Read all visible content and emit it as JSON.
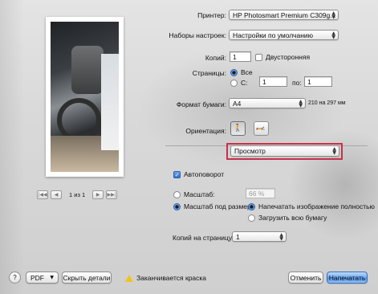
{
  "printer": {
    "label": "Принтер:",
    "value": "HP Photosmart Premium C309g..."
  },
  "presets": {
    "label": "Наборы настроек:",
    "value": "Настройки по умолчанию"
  },
  "copies": {
    "label": "Копий:",
    "value": "1",
    "duplex_label": "Двусторонняя",
    "duplex_checked": false
  },
  "pages": {
    "label": "Страницы:",
    "all_label": "Все",
    "from_label": "С:",
    "from_value": "1",
    "to_label": "по:",
    "to_value": "1",
    "selected": "all"
  },
  "paper": {
    "label": "Формат бумаги:",
    "value": "A4",
    "size_text": "210 на 297 мм"
  },
  "orientation": {
    "label": "Ориентация:",
    "selected": "portrait"
  },
  "section_popup": {
    "value": "Просмотр",
    "highlight_color": "#c8304a"
  },
  "options": {
    "autorotate_label": "Автоповорот",
    "autorotate_checked": true,
    "scale_label": "Масштаб:",
    "scale_value": "66 %",
    "scale_to_fit_label": "Масштаб под размер:",
    "print_entire_label": "Напечатать изображение полностью",
    "fill_paper_label": "Загрузить всю бумагу",
    "selected_scale_mode": "scale_to_fit",
    "selected_fit_mode": "print_entire"
  },
  "copies_per_page": {
    "label": "Копий на страницу:",
    "value": "1"
  },
  "preview": {
    "page_text": "1 из 1"
  },
  "footer": {
    "help": "?",
    "pdf": "PDF",
    "hide_details": "Скрыть детали",
    "warning": "Заканчивается краска",
    "cancel": "Отменить",
    "print": "Напечатать"
  }
}
